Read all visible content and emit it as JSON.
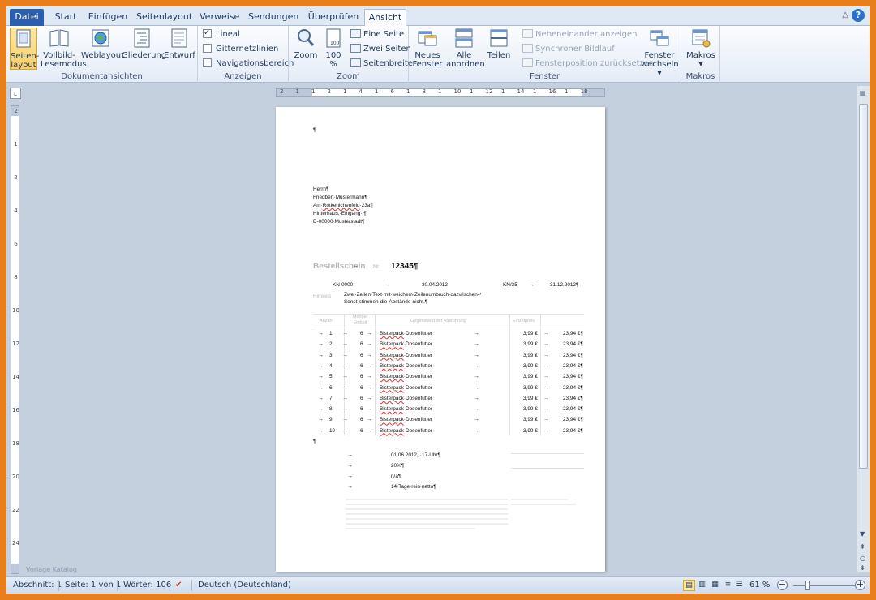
{
  "tabs": {
    "file": "Datei",
    "items": [
      "Start",
      "Einfügen",
      "Seitenlayout",
      "Verweise",
      "Sendungen",
      "Überprüfen",
      "Ansicht"
    ],
    "active": "Ansicht"
  },
  "ribbon": {
    "dokumentansichten": {
      "label": "Dokumentansichten",
      "seitenlayout_l1": "Seiten-",
      "seitenlayout_l2": "layout",
      "vollbild_l1": "Vollbild-",
      "vollbild_l2": "Lesemodus",
      "weblayout": "Weblayout",
      "gliederung": "Gliederung",
      "entwurf": "Entwurf"
    },
    "anzeigen": {
      "label": "Anzeigen",
      "lineal": "Lineal",
      "gitternetzlinien": "Gitternetzlinien",
      "navigationsbereich": "Navigationsbereich"
    },
    "zoom": {
      "label": "Zoom",
      "zoom": "Zoom",
      "hundert_l1": "100",
      "hundert_l2": "%",
      "eine_seite": "Eine Seite",
      "zwei_seiten": "Zwei Seiten",
      "seitenbreite": "Seitenbreite"
    },
    "fenster": {
      "label": "Fenster",
      "neues_l1": "Neues",
      "neues_l2": "Fenster",
      "alle_l1": "Alle",
      "alle_l2": "anordnen",
      "teilen": "Teilen",
      "nebeneinander": "Nebeneinander anzeigen",
      "synchroner": "Synchroner Bildlauf",
      "fensterposition": "Fensterposition zurücksetzen",
      "wechseln_l1": "Fenster",
      "wechseln_l2": "wechseln ▾"
    },
    "makros": {
      "label": "Makros",
      "makros": "Makros",
      "arrow": "▾"
    }
  },
  "ruler_h": [
    "2",
    "1",
    "1",
    "2",
    "1",
    "4",
    "1",
    "6",
    "1",
    "8",
    "1",
    "10",
    "1",
    "12",
    "1",
    "14",
    "1",
    "16",
    "1",
    "18"
  ],
  "ruler_v": [
    "2",
    "1",
    "2",
    "4",
    "6",
    "8",
    "10",
    "12",
    "14",
    "16",
    "18",
    "20",
    "22",
    "24"
  ],
  "document": {
    "para_top": "¶",
    "address": [
      "Herrn¶",
      "Friedbert·Mustermann¶",
      "Am·Rotkehlchenfeld·23a¶",
      "Hinterhaus,·Eingang·I¶",
      "D-00000·Musterstadt¶"
    ],
    "address_underline": "Rotkehlchenfeld",
    "bestell_title": "Bestellschein",
    "bestell_nr_label": "Nr.",
    "bestell_nr": "12345¶",
    "ref1": "KN-0000",
    "date1": "30.04.2012",
    "ref2": "KN/35",
    "date2": "31.12.2012¶",
    "notiz_label": "Hinweis",
    "notiz_line1": "Zwei·Zeilen·Text·mit·weichem·Zeilenumbruch·dazwischen↵",
    "notiz_line2": "Sonst·stimmen·die·Abstände·nicht.¶",
    "col_headers": [
      "Anzahl",
      "Menge/ Einheit",
      "Gegenstand der Ausführung",
      "Einzelpreis"
    ],
    "rows": [
      {
        "n": "1",
        "qty": "6",
        "item": "Bisterpack",
        "item2": "·Dosenfutter",
        "price": "3,99 €",
        "total": "23,94 €¶"
      },
      {
        "n": "2",
        "qty": "6",
        "item": "Bisterpack",
        "item2": "·Dosenfutter",
        "price": "3,99 €",
        "total": "23,94 €¶"
      },
      {
        "n": "3",
        "qty": "6",
        "item": "Bisterpack",
        "item2": "·Dosenfutter",
        "price": "3,99 €",
        "total": "23,94 €¶"
      },
      {
        "n": "4",
        "qty": "6",
        "item": "Bisterpack",
        "item2": "·Dosenfutter",
        "price": "3,99 €",
        "total": "23,94 €¶"
      },
      {
        "n": "5",
        "qty": "6",
        "item": "Bisterpack",
        "item2": "·Dosenfutter",
        "price": "3,99 €",
        "total": "23,94 €¶"
      },
      {
        "n": "6",
        "qty": "6",
        "item": "Bisterpack",
        "item2": "·Dosenfutter",
        "price": "3,99 €",
        "total": "23,94 €¶"
      },
      {
        "n": "7",
        "qty": "6",
        "item": "Bisterpack",
        "item2": "·Dosenfutter",
        "price": "3,99 €",
        "total": "23,94 €¶"
      },
      {
        "n": "8",
        "qty": "6",
        "item": "Bisterpack",
        "item2": "·Dosenfutter",
        "price": "3,99 €",
        "total": "23,94 €¶"
      },
      {
        "n": "9",
        "qty": "6",
        "item": "Bisterpack",
        "item2": "·Dosenfutter",
        "price": "3,99 €",
        "total": "23,94 €¶"
      },
      {
        "n": "10",
        "qty": "6",
        "item": "Bisterpack",
        "item2": "·Dosenfutter",
        "price": "3,99 €",
        "total": "23,94 €¶"
      }
    ],
    "para_after_table": "¶",
    "details": [
      "01.06.2012,··17·Uhr¶",
      "20%¶",
      "n/a¶",
      "14·Tage·rein·netto¶"
    ],
    "arrow": "→"
  },
  "status": {
    "abschnitt": "Abschnitt: 1",
    "seite": "Seite: 1 von 1",
    "woerter": "Wörter: 106",
    "sprache": "Deutsch (Deutschland)",
    "zoom": "61 %",
    "minus": "−",
    "plus": "+"
  },
  "watermark": "Vorlage Katalog"
}
